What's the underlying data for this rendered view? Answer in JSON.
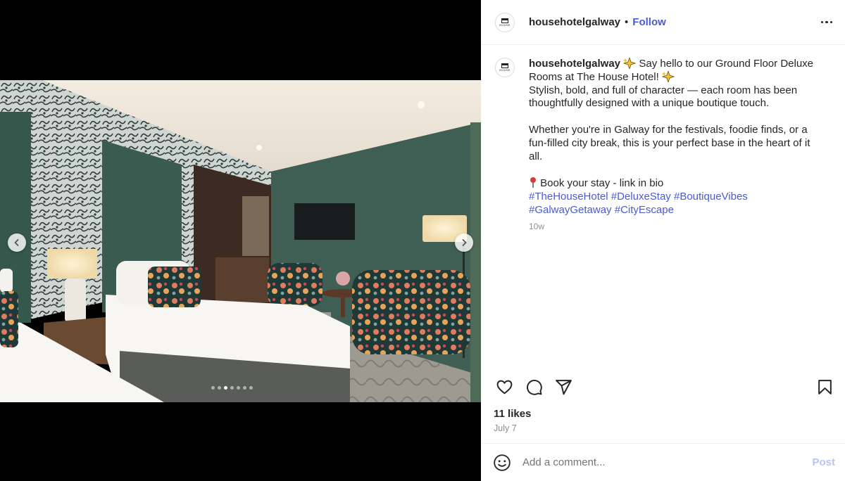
{
  "post": {
    "username": "househotelgalway",
    "follow_label": "Follow",
    "avatar_text": "HOUSE",
    "caption": {
      "line1": "Say hello to our Ground Floor Deluxe Rooms at The House Hotel!",
      "line2": "Stylish, bold, and full of character — each room has been thoughtfully designed with a unique boutique touch.",
      "line3": "Whether you're in Galway for the festivals, foodie finds, or a fun-filled city break, this is your perfect base in the heart of it all.",
      "line4": "Book your stay - link in bio",
      "hashtags": [
        "#TheHouseHotel",
        "#DeluxeStay",
        "#BoutiqueVibes",
        "#GalwayGetaway",
        "#CityEscape"
      ]
    },
    "caption_age": "10w",
    "likes": "11 likes",
    "date": "July 7",
    "carousel": {
      "count": 7,
      "active_index": 2
    }
  },
  "comment": {
    "placeholder": "Add a comment...",
    "post_label": "Post"
  },
  "icons": {
    "prev": "chevron-left-icon",
    "next": "chevron-right-icon",
    "more": "more-options-icon",
    "like": "heart-icon",
    "comment": "comment-icon",
    "share": "share-icon",
    "save": "bookmark-icon",
    "emoji": "emoji-icon",
    "sparkle": "sparkles-emoji",
    "pushpin": "round-pushpin-emoji"
  },
  "colors": {
    "link": "#4a5bd3",
    "post_disabled": "#b7c3f7",
    "muted": "#8e8e8e",
    "wall_green": "#3f5f54"
  }
}
